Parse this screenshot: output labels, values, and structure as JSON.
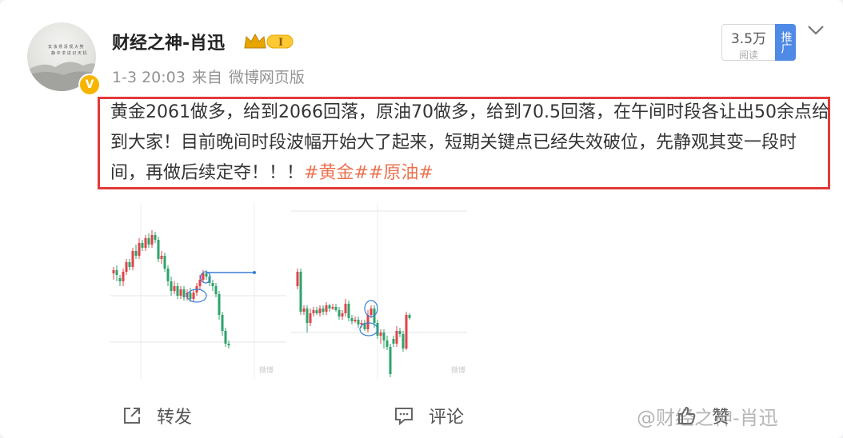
{
  "post": {
    "username": "财经之神-肖迅",
    "level_badge": "I",
    "verified_mark": "V",
    "time": "1-3 20:03",
    "source_prefix": "来自",
    "source": "微博网页版",
    "reads_count": "3.5万",
    "reads_label": "阅读",
    "push_label": "推广",
    "text_main": "黄金2061做多，给到2066回落，原油70做多，给到70.5回落，在午间时段各让出50余点给到大家！目前晚间时段波幅开始大了起来，短期关键点已经失效破位，先静观其变一段时间，再做后续定夺！！！",
    "tags": [
      "#黄金#",
      "#原油#"
    ]
  },
  "actions": {
    "repost_label": "转发",
    "comment_label": "评论",
    "like_label": "赞"
  },
  "watermark": {
    "handle": "@财经之神-肖迅",
    "image_mark": "微博"
  },
  "icons": {
    "repost": "share-out-icon",
    "comment": "comment-icon",
    "like": "thumb-up-icon",
    "more": "chevron-down-icon",
    "crown": "crown-icon"
  },
  "colors": {
    "highlight_border": "#e23a3a",
    "tag_color": "#eb7350",
    "candle_up": "#e0434a",
    "candle_down": "#2ea36b",
    "annotation": "#3a7fd4"
  }
}
